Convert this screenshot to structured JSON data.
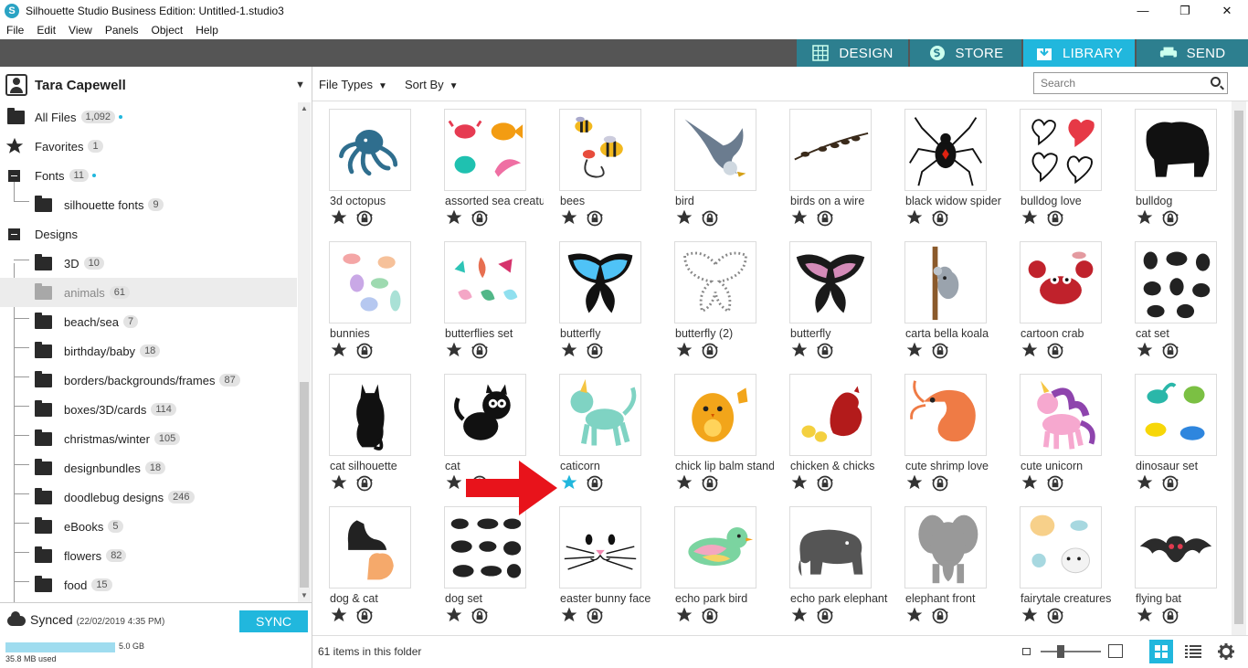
{
  "window": {
    "title": "Silhouette Studio Business Edition: Untitled-1.studio3",
    "min": "—",
    "max": "❐",
    "close": "✕"
  },
  "menu": [
    "File",
    "Edit",
    "View",
    "Panels",
    "Object",
    "Help"
  ],
  "tabs": [
    {
      "label": "DESIGN",
      "icon": "grid-icon"
    },
    {
      "label": "STORE",
      "icon": "store-icon"
    },
    {
      "label": "LIBRARY",
      "icon": "library-icon",
      "active": true
    },
    {
      "label": "SEND",
      "icon": "printer-icon"
    }
  ],
  "sidebar": {
    "user": "Tara Capewell",
    "items": [
      {
        "label": "All Files",
        "count": "1,092",
        "type": "folder",
        "dot": true
      },
      {
        "label": "Favorites",
        "count": "1",
        "type": "star"
      },
      {
        "label": "Fonts",
        "count": "11",
        "type": "folder",
        "dot": true,
        "expanded": true
      },
      {
        "label": "silhouette fonts",
        "count": "9",
        "type": "folder",
        "child": true
      },
      {
        "label": "Designs",
        "count": "",
        "type": "expand"
      },
      {
        "label": "3D",
        "count": "10",
        "type": "folder",
        "child": true
      },
      {
        "label": "animals",
        "count": "61",
        "type": "folder",
        "child": true,
        "selected": true
      },
      {
        "label": "beach/sea",
        "count": "7",
        "type": "folder",
        "child": true
      },
      {
        "label": "birthday/baby",
        "count": "18",
        "type": "folder",
        "child": true
      },
      {
        "label": "borders/backgrounds/frames",
        "count": "87",
        "type": "folder",
        "child": true
      },
      {
        "label": "boxes/3D/cards",
        "count": "114",
        "type": "folder",
        "child": true
      },
      {
        "label": "christmas/winter",
        "count": "105",
        "type": "folder",
        "child": true
      },
      {
        "label": "designbundles",
        "count": "18",
        "type": "folder",
        "child": true
      },
      {
        "label": "doodlebug designs",
        "count": "246",
        "type": "folder",
        "child": true
      },
      {
        "label": "eBooks",
        "count": "5",
        "type": "folder",
        "child": true
      },
      {
        "label": "flowers",
        "count": "82",
        "type": "folder",
        "child": true
      },
      {
        "label": "food",
        "count": "15",
        "type": "folder",
        "child": true
      }
    ],
    "sync": {
      "status": "Synced",
      "timestamp": "(22/02/2019 4:35 PM)",
      "button": "SYNC",
      "storage_max": "5.0 GB",
      "storage_used": "35.8 MB used",
      "storage_fraction": 0.007
    }
  },
  "toolbar": {
    "file_types": "File Types",
    "sort_by": "Sort By",
    "search_placeholder": "Search"
  },
  "library": [
    {
      "name": "3d octopus",
      "art": "octopus"
    },
    {
      "name": "assorted sea creatures",
      "art": "sea"
    },
    {
      "name": "bees",
      "art": "bees"
    },
    {
      "name": "bird",
      "art": "swallow"
    },
    {
      "name": "birds on a wire",
      "art": "wire"
    },
    {
      "name": "black widow spider",
      "art": "spider"
    },
    {
      "name": "bulldog love",
      "art": "hearts"
    },
    {
      "name": "bulldog",
      "art": "bulldog"
    },
    {
      "name": "bunnies",
      "art": "bunnies"
    },
    {
      "name": "butterflies set",
      "art": "butterflies"
    },
    {
      "name": "butterfly",
      "art": "bluebutterfly"
    },
    {
      "name": "butterfly (2)",
      "art": "dotbutterfly"
    },
    {
      "name": "butterfly",
      "art": "darkbutterfly"
    },
    {
      "name": "carta bella koala",
      "art": "koala"
    },
    {
      "name": "cartoon crab",
      "art": "crab"
    },
    {
      "name": "cat set",
      "art": "catset"
    },
    {
      "name": "cat silhouette",
      "art": "catsil"
    },
    {
      "name": "cat",
      "art": "cat"
    },
    {
      "name": "caticorn",
      "art": "caticorn",
      "favorite": true
    },
    {
      "name": "chick lip balm stand",
      "art": "chick"
    },
    {
      "name": "chicken & chicks",
      "art": "chicken"
    },
    {
      "name": "cute shrimp love",
      "art": "shrimp"
    },
    {
      "name": "cute unicorn",
      "art": "unicorn"
    },
    {
      "name": "dinosaur set",
      "art": "dino"
    },
    {
      "name": "dog & cat",
      "art": "dogcat"
    },
    {
      "name": "dog set",
      "art": "dogset"
    },
    {
      "name": "easter bunny face",
      "art": "bunnyface"
    },
    {
      "name": "echo park bird",
      "art": "echobird"
    },
    {
      "name": "echo park elephant",
      "art": "elephant"
    },
    {
      "name": "elephant front",
      "art": "elephantfront"
    },
    {
      "name": "fairytale creatures",
      "art": "fairytale"
    },
    {
      "name": "flying bat",
      "art": "bat"
    }
  ],
  "status": {
    "items_text": "61 items in this folder"
  },
  "colors": {
    "accent": "#21b7dd",
    "tab": "#2d7f8f",
    "dark": "#555555",
    "annotation_arrow": "#e8131b"
  }
}
